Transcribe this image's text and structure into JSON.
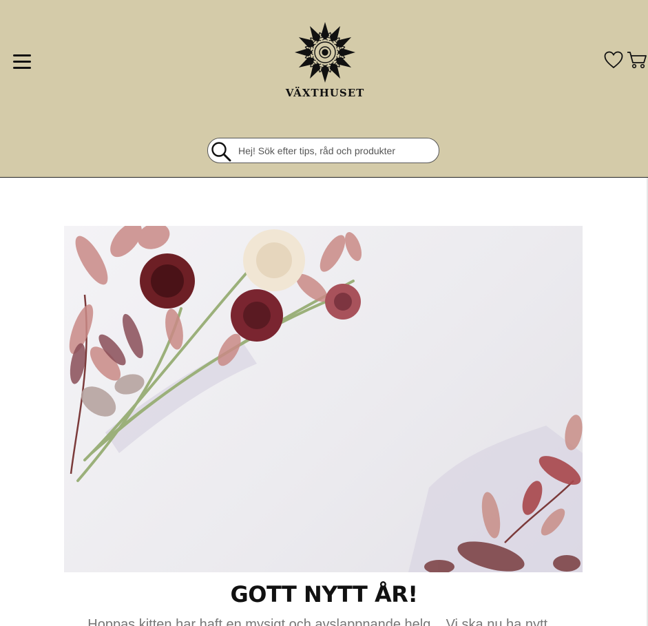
{
  "header": {
    "brand": "VÄXTHUSET",
    "menu_icon": "hamburger-menu-icon",
    "logo_icon": "mandala-logo-icon",
    "wishlist_icon": "heart-icon",
    "cart_icon": "shopping-cart-icon",
    "background": "#d4cba9"
  },
  "search": {
    "placeholder": "Hej! Sök efter tips, råd och produkter",
    "icon": "search-icon"
  },
  "main": {
    "hero_image": "flowers-and-leaves-photo",
    "title": "GOTT NYTT ÅR!",
    "intro": "Hoppas kitten har haft en mysigt och avslappnande helg... Vi ska nu ha nytt..."
  }
}
